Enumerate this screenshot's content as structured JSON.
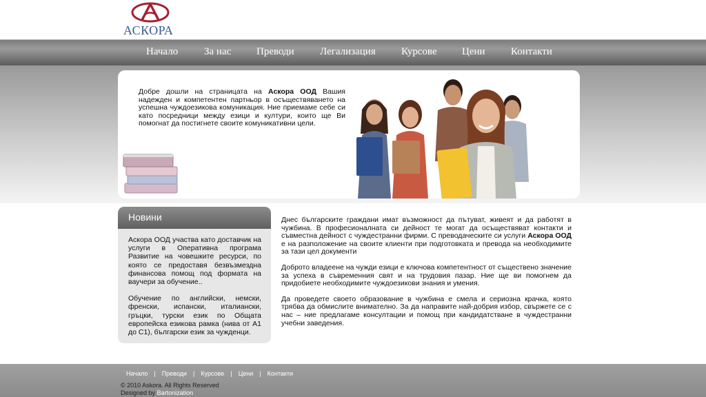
{
  "logo": {
    "text": "АСКОРА"
  },
  "nav": {
    "items": [
      {
        "label": "Начало"
      },
      {
        "label": "За нас"
      },
      {
        "label": "Преводи"
      },
      {
        "label": "Легализация"
      },
      {
        "label": "Курсове"
      },
      {
        "label": "Цени"
      },
      {
        "label": "Контакти"
      }
    ]
  },
  "hero": {
    "text_before": "Добре дошли на страницата на ",
    "company": "Аскора ООД",
    "text_after": " Вашия надежден и компетентен партньор в осъществяването на успешна чуждоезикова комуникация. Ние приемаме себе си като посредници между езици и култури, които ще Ви помогнат да постигнете своите комуникативни цели."
  },
  "news": {
    "title": "Новини",
    "p1": "Аскора ООД участва като доставчик на услуги в Оперативна програма Развитие на човешките ресурси, по която се предоставя безвъзмездна финансова помощ под формата на ваучери за обучение..",
    "p2": "Обучение по английски, немски, френски, испански, италиански, гръцки, турски език по Общата европейска езикова рамка (нива от А1 до С1), български език за чужденци."
  },
  "main": {
    "p1_before": "Днес българските граждани имат възможност да пътуват, живеят и да работят в чужбина. В професионалната си дейност те могат да осъществяват контакти и съвместна дейност с чуждестранни фирми. С преводаческите си услуги ",
    "p1_company": "Аскора ООД",
    "p1_after": " е на разположение на своите клиенти при подготовката и превода на необходимите за тази цел документи",
    "p2": "Доброто владеене на чужди езици е ключова компетентност от съществено значение за успеха в съвременния свят и на трудовия пазар. Ние ще ви помогнем да придобиете необходимите чуждоезикови знания и умения.",
    "p3": "Да проведете своето образование в чужбина е смела и сериозна крачка, която трябва да обмислите внимателно. За да направите най-добрия избор, свържете се с нас – ние предлагаме консултации и помощ при кандидатстване в чуждестранни учебни заведения."
  },
  "footer": {
    "links": [
      {
        "label": "Начало"
      },
      {
        "label": "Преводи"
      },
      {
        "label": "Курсове"
      },
      {
        "label": "Цени"
      },
      {
        "label": "Контакти"
      }
    ],
    "separator": "|",
    "copyright": "© 2010 Askora. All Rights Reserved",
    "designed_by": "Designed by",
    "designer": "Bartonization"
  },
  "colors": {
    "logo_red": "#a32030",
    "logo_blue": "#3a5a8c",
    "nav_bg": "#7c7c7c",
    "news_bg": "#e7e7e7"
  }
}
